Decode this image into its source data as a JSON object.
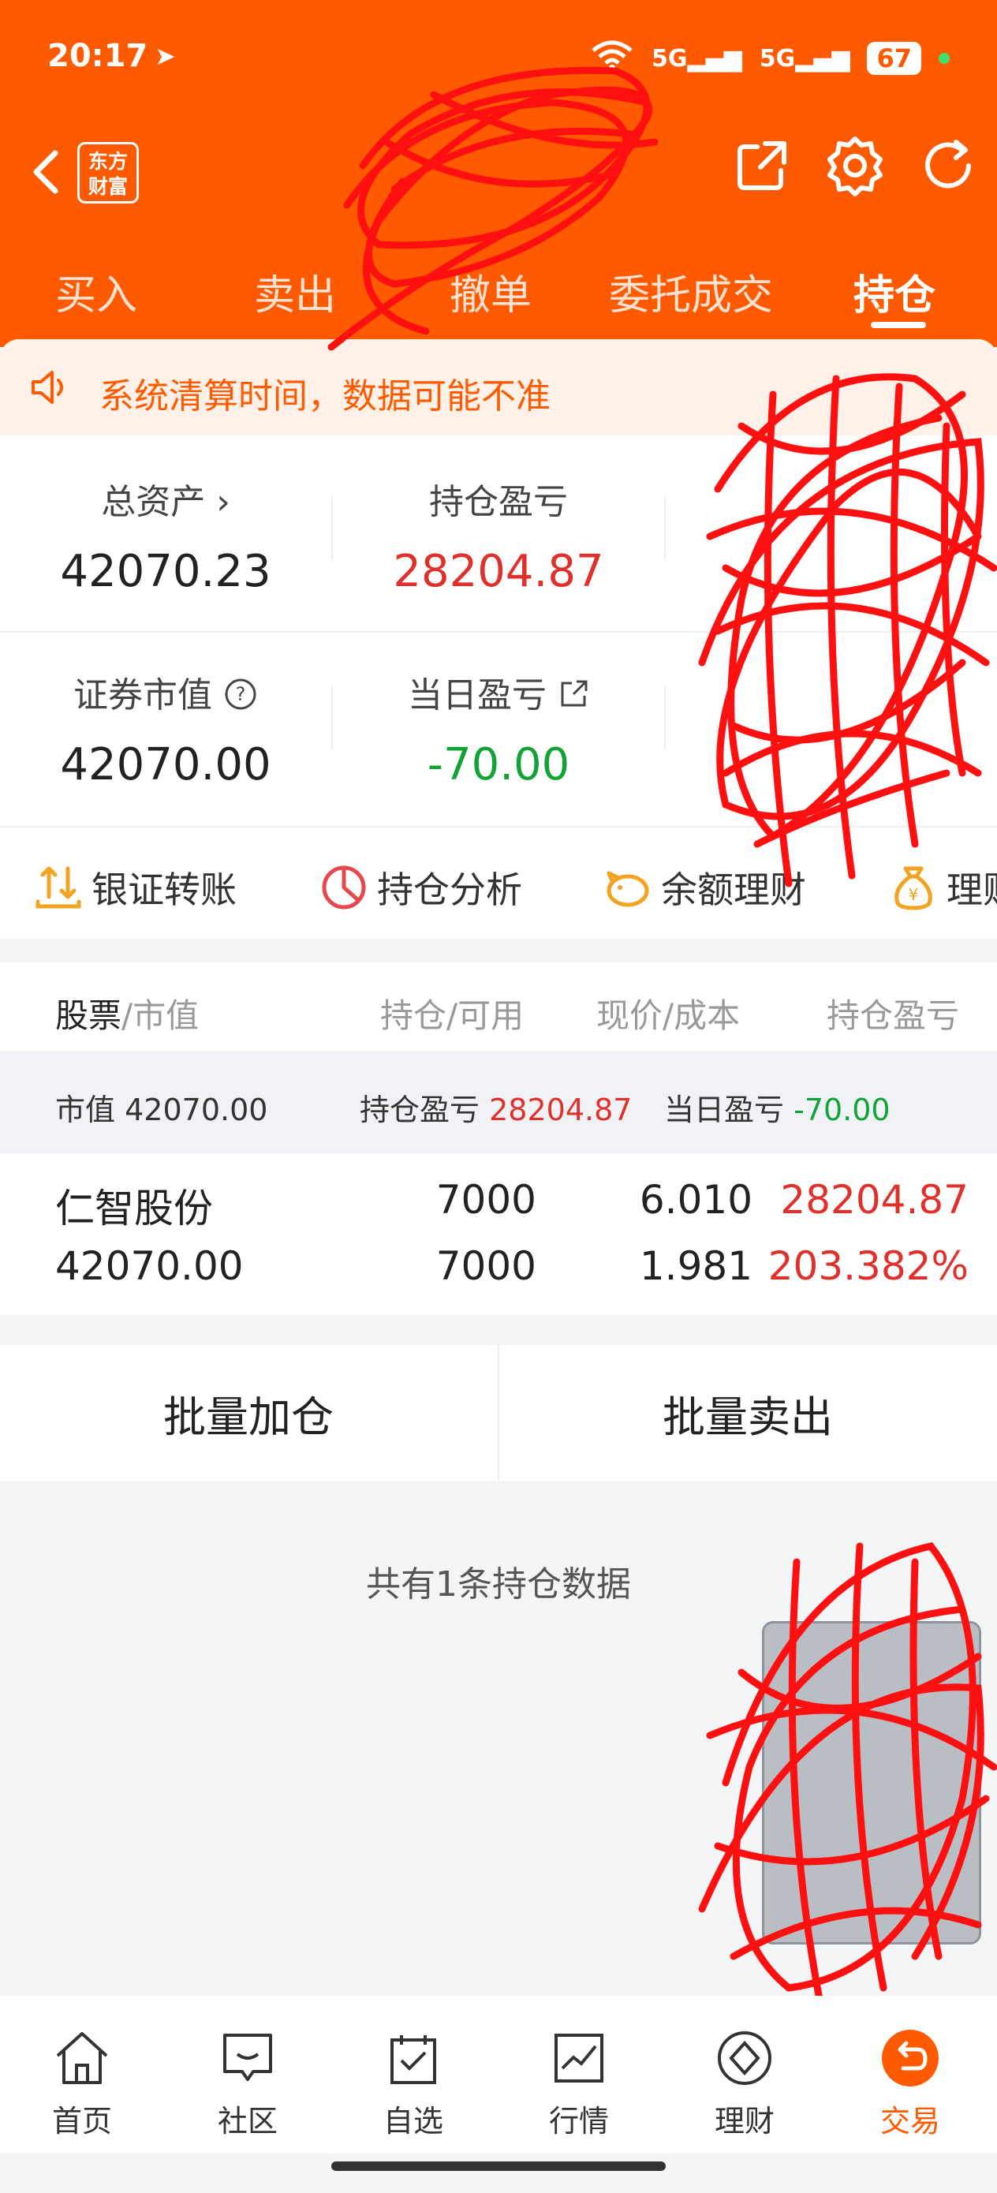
{
  "status": {
    "time": "20:17",
    "battery": "67",
    "signal1": "5G",
    "signal2": "5G"
  },
  "header": {
    "brand_line1": "东方",
    "brand_line2": "财富",
    "tabs": [
      {
        "label": "买入"
      },
      {
        "label": "卖出"
      },
      {
        "label": "撤单"
      },
      {
        "label": "委托成交"
      },
      {
        "label": "持仓"
      }
    ]
  },
  "notice": {
    "text": "系统清算时间，数据可能不准"
  },
  "metrics": {
    "total_assets_label": "总资产 ›",
    "total_assets_value": "42070.23",
    "position_pnl_label": "持仓盈亏",
    "position_pnl_value": "28204.87",
    "market_value_label": "证券市值",
    "market_value_value": "42070.00",
    "daily_pnl_label": "当日盈亏",
    "daily_pnl_value": "-70.00"
  },
  "quick_actions": [
    {
      "label": "银证转账"
    },
    {
      "label": "持仓分析"
    },
    {
      "label": "余额理财"
    },
    {
      "label": "理财"
    }
  ],
  "table": {
    "head_stock": "股票",
    "head_value": "/市值",
    "head_position": "持仓/可用",
    "head_price": "现价/成本",
    "head_pnl": "持仓盈亏",
    "summary_mv_label": "市值",
    "summary_mv_value": "42070.00",
    "summary_pnl_label": "持仓盈亏",
    "summary_pnl_value": "28204.87",
    "summary_daily_label": "当日盈亏",
    "summary_daily_value": "-70.00",
    "rows": [
      {
        "name": "仁智股份",
        "market_value": "42070.00",
        "position": "7000",
        "available": "7000",
        "price": "6.010",
        "cost": "1.981",
        "pnl": "28204.87",
        "pnl_pct": "203.382%"
      }
    ]
  },
  "batch": {
    "add": "批量加仓",
    "sell": "批量卖出"
  },
  "count_text": "共有1条持仓数据",
  "bottom_tabs": [
    {
      "label": "首页"
    },
    {
      "label": "社区"
    },
    {
      "label": "自选"
    },
    {
      "label": "行情"
    },
    {
      "label": "理财"
    },
    {
      "label": "交易"
    }
  ],
  "colors": {
    "brand": "#ff5a00",
    "up": "#e0302c",
    "down": "#12a336"
  }
}
